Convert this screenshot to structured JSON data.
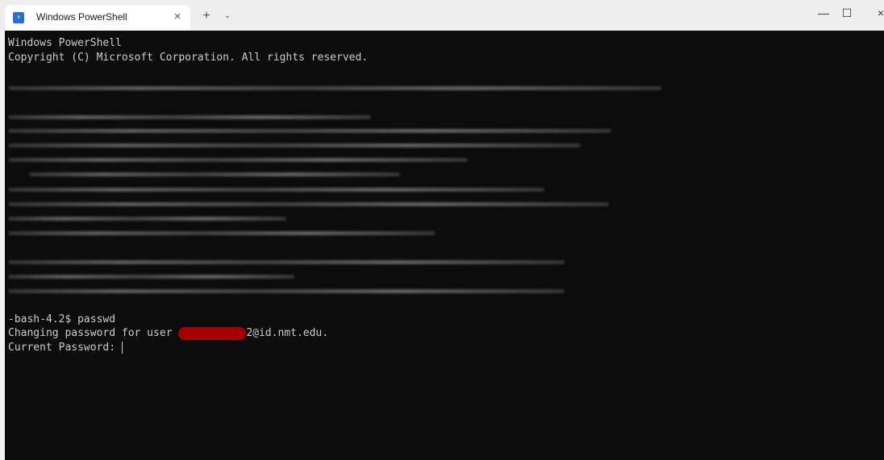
{
  "tab": {
    "title": "Windows PowerShell",
    "icon": "powershell-icon",
    "close_glyph": "×",
    "new_tab_glyph": "+",
    "dropdown_glyph": "⌄"
  },
  "window_controls": {
    "minimize_glyph": "—",
    "maximize_glyph": "☐",
    "close_glyph": "×"
  },
  "terminal": {
    "header_line1": "Windows PowerShell",
    "header_line2": "Copyright (C) Microsoft Corporation. All rights reserved.",
    "prompt_command": "-bash-4.2$ passwd",
    "changing_prefix": "Changing password for user ",
    "changing_suffix": "2@id.nmt.edu.",
    "current_password_prompt": "Current Password: ",
    "background_color": "#0c0c0c",
    "text_color": "#cccccc",
    "redaction_color": "#a30000"
  }
}
